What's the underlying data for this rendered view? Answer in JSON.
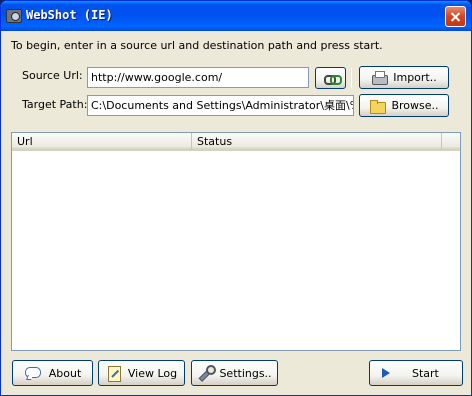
{
  "window": {
    "title": "WebShot (IE)"
  },
  "instructions": "To begin, enter in a source url and destination path and press start.",
  "form": {
    "source_label": "Source Url:",
    "source_value": "http://www.google.com/",
    "target_label": "Target Path:",
    "target_value": "C:\\Documents and Settings\\Administrator\\桌面\\%d.jpg",
    "import_label": "Import..",
    "browse_label": "Browse.."
  },
  "list": {
    "columns": [
      "Url",
      "Status",
      ""
    ],
    "rows": []
  },
  "footer": {
    "about_label": "About",
    "viewlog_label": "View Log",
    "settings_label": "Settings..",
    "start_label": "Start"
  },
  "icons": {
    "app": "camera-icon",
    "link": "link-icon",
    "import": "printer-icon",
    "browse": "folder-icon",
    "about": "speech-icon",
    "viewlog": "notepad-icon",
    "settings": "wrench-icon",
    "start": "play-icon"
  },
  "colors": {
    "titlebar": "#0053ee",
    "window_bg": "#ece9d8",
    "close": "#d6441f"
  }
}
